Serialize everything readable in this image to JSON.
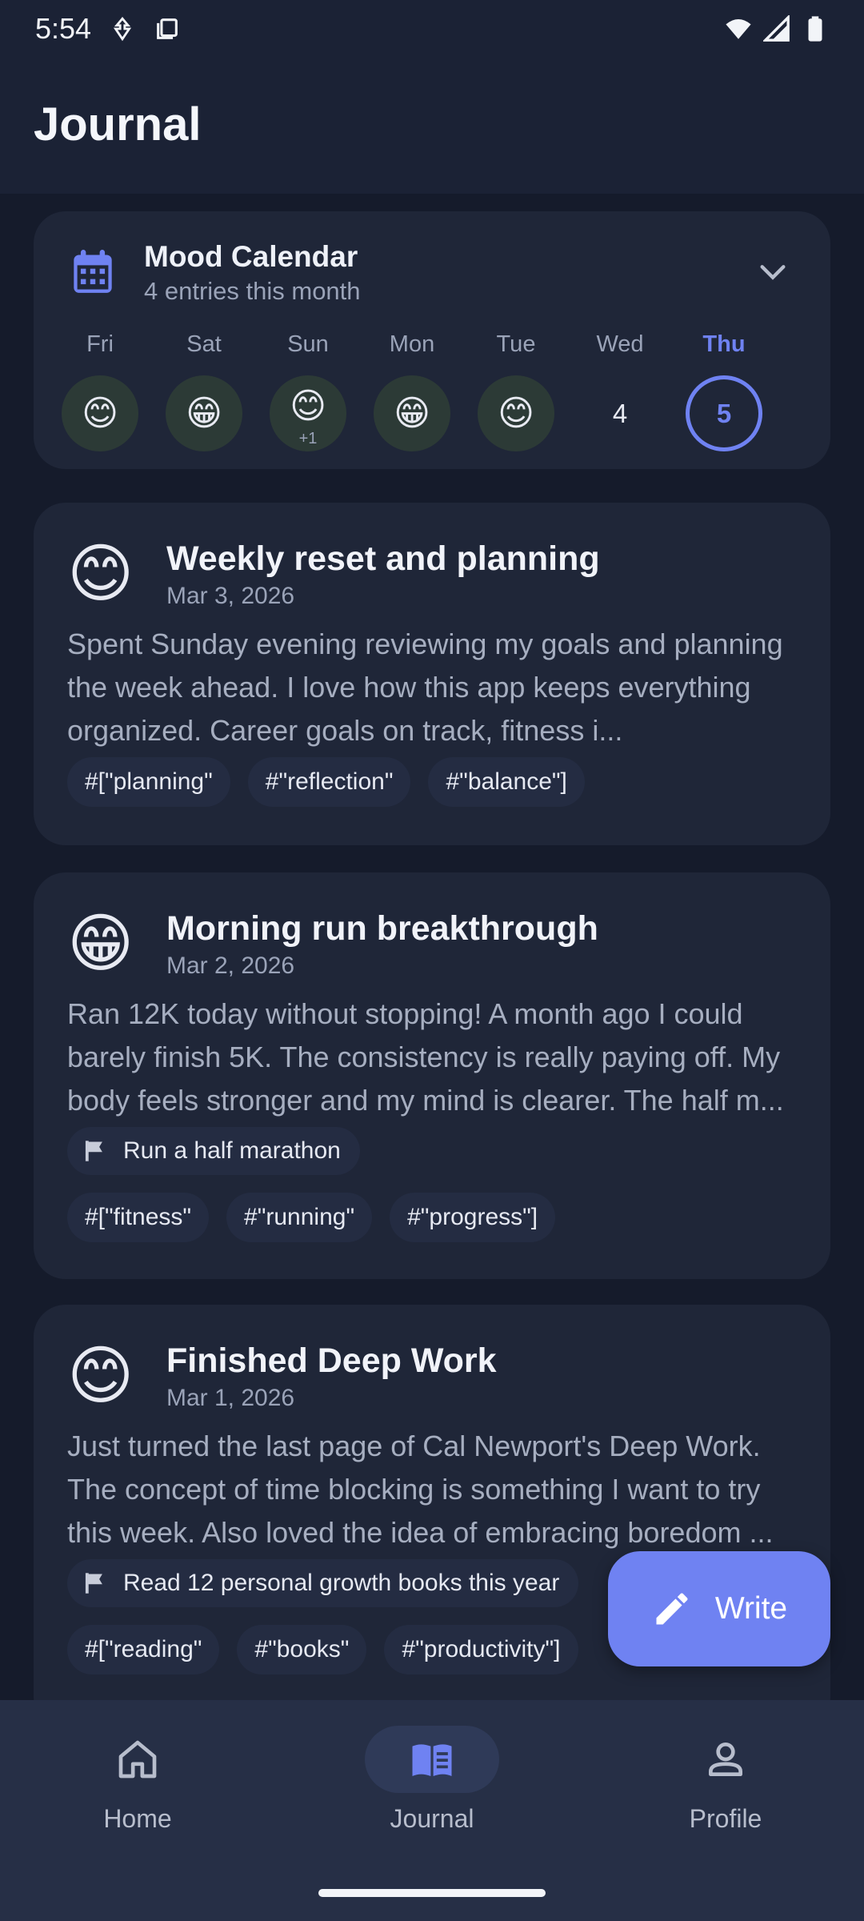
{
  "status_bar": {
    "time": "5:54"
  },
  "header": {
    "title": "Journal"
  },
  "mood_calendar": {
    "title": "Mood Calendar",
    "subtitle": "4 entries this month",
    "days": [
      {
        "label": "Fri",
        "emoji": "😊",
        "extra": ""
      },
      {
        "label": "Sat",
        "emoji": "😁",
        "extra": ""
      },
      {
        "label": "Sun",
        "emoji": "😊",
        "extra": "+1"
      },
      {
        "label": "Mon",
        "emoji": "😁",
        "extra": ""
      },
      {
        "label": "Tue",
        "emoji": "😊",
        "extra": ""
      },
      {
        "label": "Wed",
        "number": "4"
      },
      {
        "label": "Thu",
        "number": "5"
      }
    ]
  },
  "entries": [
    {
      "emoji": "😊",
      "title": "Weekly reset and planning",
      "date": "Mar 3, 2026",
      "body": "Spent Sunday evening reviewing my goals and planning the week ahead. I love how this app keeps everything organized. Career goals on track, fitness i...",
      "tags": [
        "#[\"planning\"",
        "#\"reflection\"",
        "#\"balance\"]"
      ]
    },
    {
      "emoji": "😁",
      "title": "Morning run breakthrough",
      "date": "Mar 2, 2026",
      "body": "Ran 12K today without stopping! A month ago I could barely finish 5K. The consistency is really paying off. My body feels stronger and my mind is clearer. The half m...",
      "goal": "Run a half marathon",
      "tags": [
        "#[\"fitness\"",
        "#\"running\"",
        "#\"progress\"]"
      ]
    },
    {
      "emoji": "😊",
      "title": "Finished Deep Work",
      "date": "Mar 1, 2026",
      "body": "Just turned the last page of Cal Newport's Deep Work. The concept of time blocking is something I want to try this week. Also loved the idea of embracing boredom ...",
      "goal": "Read 12 personal growth books this year",
      "tags": [
        "#[\"reading\"",
        "#\"books\"",
        "#\"productivity\"]"
      ]
    }
  ],
  "fab": {
    "label": "Write"
  },
  "nav": [
    {
      "label": "Home",
      "icon": "home-icon"
    },
    {
      "label": "Journal",
      "icon": "book-icon",
      "active": true
    },
    {
      "label": "Profile",
      "icon": "person-icon"
    }
  ],
  "colors": {
    "accent": "#6f82f2",
    "background": "#151b2b",
    "card": "#1f2638"
  }
}
